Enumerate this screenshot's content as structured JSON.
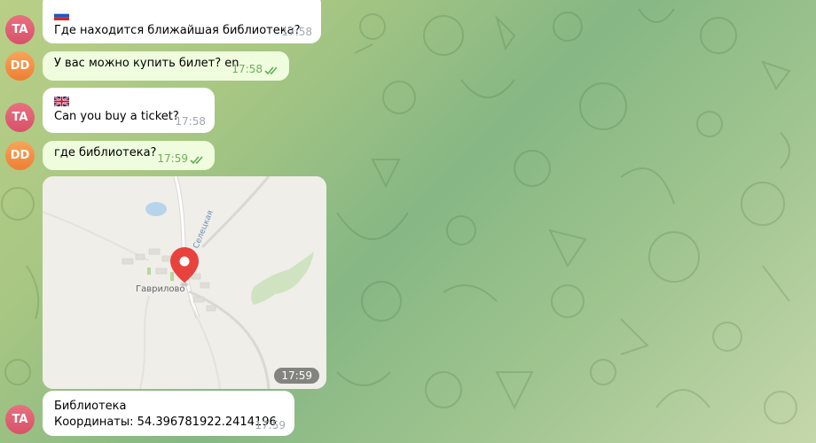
{
  "messages": [
    {
      "sender_initials": "TA",
      "flag": "ru-flag",
      "text": "Где находится ближайшая библиотека?",
      "time": "17:58"
    },
    {
      "sender_initials": "DD",
      "text": "У вас можно купить билет? en",
      "time": "17:58",
      "status": "read"
    },
    {
      "sender_initials": "TA",
      "flag": "gb-flag",
      "text": "Can you buy a ticket?",
      "time": "17:58"
    },
    {
      "sender_initials": "DD",
      "text": "где библиотека?",
      "time": "17:59",
      "status": "read"
    }
  ],
  "map_message": {
    "place_label": "Гаврилово",
    "road_label": "Селецкая",
    "time": "17:59"
  },
  "location_message": {
    "sender_initials": "TA",
    "title": "Библиотека",
    "coords": "Координаты: 54.396781922.2414196",
    "time": "17:59"
  },
  "colors": {
    "incoming_bubble": "#ffffff",
    "outgoing_bubble": "#effdde",
    "avatar_ta": "#dd5d70",
    "avatar_dd": "#f3923f",
    "read_checks": "#5fae58",
    "map_pin": "#e8423d"
  }
}
